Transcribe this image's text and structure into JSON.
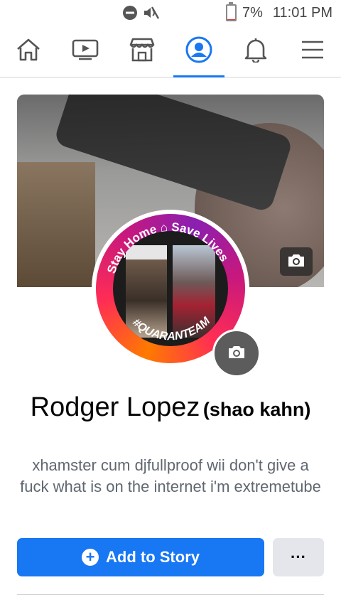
{
  "status_bar": {
    "icons": [
      "do-not-disturb-icon",
      "mute-icon",
      "battery-icon"
    ],
    "battery_percent": "7%",
    "battery_level": 0.07,
    "time": "11:01 PM"
  },
  "nav": {
    "tabs": [
      {
        "name": "home",
        "icon": "home-icon",
        "active": false
      },
      {
        "name": "watch",
        "icon": "video-icon",
        "active": false
      },
      {
        "name": "marketplace",
        "icon": "store-icon",
        "active": false
      },
      {
        "name": "profile",
        "icon": "profile-icon",
        "active": true
      },
      {
        "name": "notifications",
        "icon": "bell-icon",
        "active": false
      },
      {
        "name": "menu",
        "icon": "hamburger-icon",
        "active": false
      }
    ],
    "accent_color": "#1877f2"
  },
  "profile": {
    "frame_text_top": "Stay Home",
    "frame_text_top_right": "Save Lives",
    "frame_text_bottom": "#QUARANTEAM",
    "name": "Rodger Lopez",
    "alternate_name": "(shao kahn)",
    "bio": "xhamster cum djfullproof wii don't give a fuck what is on the internet i'm extremetube"
  },
  "actions": {
    "add_story_label": "Add to Story",
    "more_label": "···"
  }
}
